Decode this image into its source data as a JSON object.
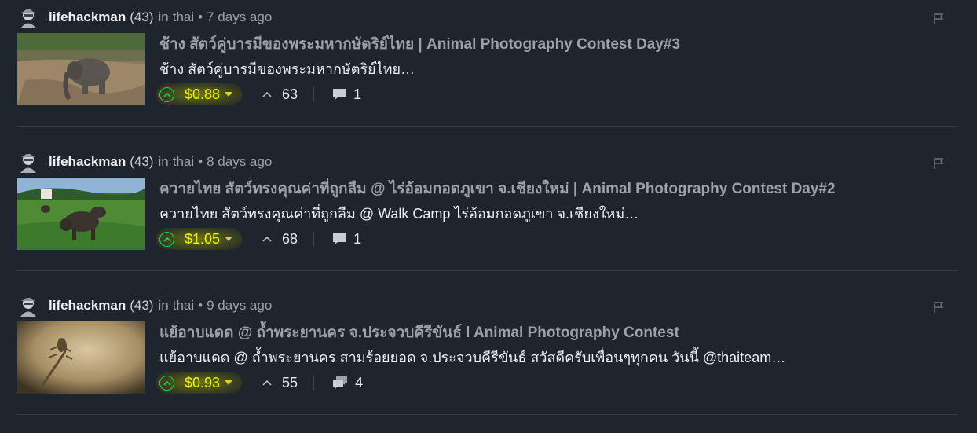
{
  "posts": [
    {
      "author": "lifehackman",
      "reputation": "(43)",
      "community_prefix": "in",
      "community": "thai",
      "age": "7 days ago",
      "title": "ช้าง สัตว์คู่บารมีของพระมหากษัตริย์ไทย | Animal Photography Contest Day#3",
      "summary": "ช้าง สัตว์คู่บารมีของพระมหากษัตริย์ไทย…",
      "payout": "$0.88",
      "votes": "63",
      "comments": "1",
      "thumb": "elephant"
    },
    {
      "author": "lifehackman",
      "reputation": "(43)",
      "community_prefix": "in",
      "community": "thai",
      "age": "8 days ago",
      "title": "ควายไทย สัตว์ทรงคุณค่าที่ถูกลืม @ ไร่อ้อมกอดภูเขา จ.เชียงใหม่ | Animal Photography Contest Day#2",
      "summary": "ควายไทย สัตว์ทรงคุณค่าที่ถูกลืม @ Walk Camp ไร่อ้อมกอดภูเขา จ.เชียงใหม่…",
      "payout": "$1.05",
      "votes": "68",
      "comments": "1",
      "thumb": "buffalo"
    },
    {
      "author": "lifehackman",
      "reputation": "(43)",
      "community_prefix": "in",
      "community": "thai",
      "age": "9 days ago",
      "title": "แย้อาบแดด @ ถ้ำพระยานคร จ.ประจวบคีรีขันธ์ l Animal Photography Contest",
      "summary": "แย้อาบแดด @ ถ้ำพระยานคร สามร้อยยอด จ.ประจวบคีรีขันธ์ สวัสดีครับเพื่อนๆทุกคน วันนี้ @thaiteam…",
      "payout": "$0.93",
      "votes": "55",
      "comments": "4",
      "thumb": "lizard"
    }
  ],
  "colors": {
    "background": "#1f252c",
    "payout": "#f2f20f",
    "upvote": "#1fd05a",
    "title": "#9aa2ab"
  },
  "icons": [
    "avatar-icon",
    "flag-icon",
    "upvote-circle-icon",
    "caret-down-icon",
    "votes-chevron-icon",
    "comment-bubble-icon"
  ]
}
